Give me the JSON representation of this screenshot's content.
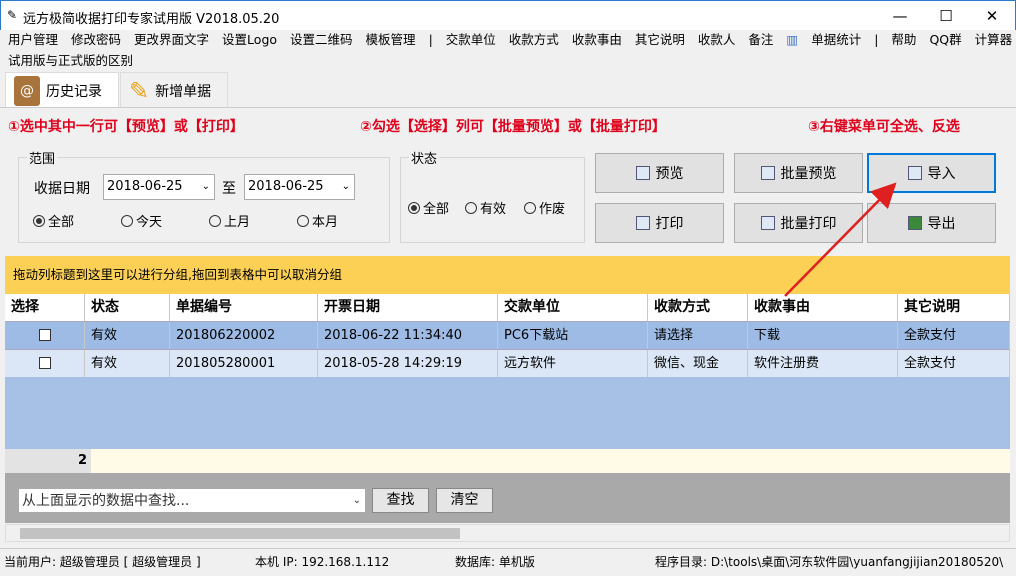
{
  "window": {
    "title": "远方极简收据打印专家试用版 V2018.05.20",
    "minimize": "—",
    "maximize": "☐",
    "close": "✕"
  },
  "menu": [
    "用户管理",
    "修改密码",
    "更改界面文字",
    "设置Logo",
    "设置二维码",
    "模板管理",
    "|",
    "交款单位",
    "收款方式",
    "收款事由",
    "其它说明",
    "收款人",
    "备注",
    "单据统计",
    "|",
    "帮助",
    "QQ群",
    "计算器"
  ],
  "menu2": "试用版与正式版的区别",
  "tabs": [
    {
      "label": "历史记录"
    },
    {
      "label": "新增单据"
    }
  ],
  "notices": [
    "①选中其中一行可【预览】或【打印】",
    "②勾选【选择】列可【批量预览】或【批量打印】",
    "③右键菜单可全选、反选"
  ],
  "range": {
    "legend": "范围",
    "date_label": "收据日期",
    "from": "2018-06-25",
    "to_label": "至",
    "to": "2018-06-25",
    "options": [
      "全部",
      "今天",
      "上月",
      "本月"
    ],
    "selected": "全部"
  },
  "status_filter": {
    "legend": "状态",
    "options": [
      "全部",
      "有效",
      "作废"
    ],
    "selected": "全部"
  },
  "buttons": {
    "preview": "预览",
    "batch_preview": "批量预览",
    "import": "导入",
    "print": "打印",
    "batch_print": "批量打印",
    "export": "导出"
  },
  "group_hint": "拖动列标题到这里可以进行分组,拖回到表格中可以取消分组",
  "table": {
    "columns": [
      "选择",
      "状态",
      "单据编号",
      "开票日期",
      "交款单位",
      "收款方式",
      "收款事由",
      "其它说明"
    ],
    "rows": [
      {
        "checked": false,
        "status": "有效",
        "no": "201806220002",
        "date": "2018-06-22 11:34:40",
        "payer": "PC6下载站",
        "method": "请选择",
        "reason": "下载",
        "note": "全款支付"
      },
      {
        "checked": false,
        "status": "有效",
        "no": "201805280001",
        "date": "2018-05-28 14:29:19",
        "payer": "远方软件",
        "method": "微信、现金",
        "reason": "软件注册费",
        "note": "全款支付"
      }
    ],
    "count": "2"
  },
  "search": {
    "placeholder": "从上面显示的数据中查找...",
    "find": "查找",
    "clear": "清空"
  },
  "statusbar": {
    "user": "当前用户: 超级管理员 [ 超级管理员 ]",
    "ip": "本机 IP: 192.168.1.112",
    "db": "数据库: 单机版",
    "dir": "程序目录: D:\\tools\\桌面\\河东软件园\\yuanfangjijian20180520\\"
  }
}
